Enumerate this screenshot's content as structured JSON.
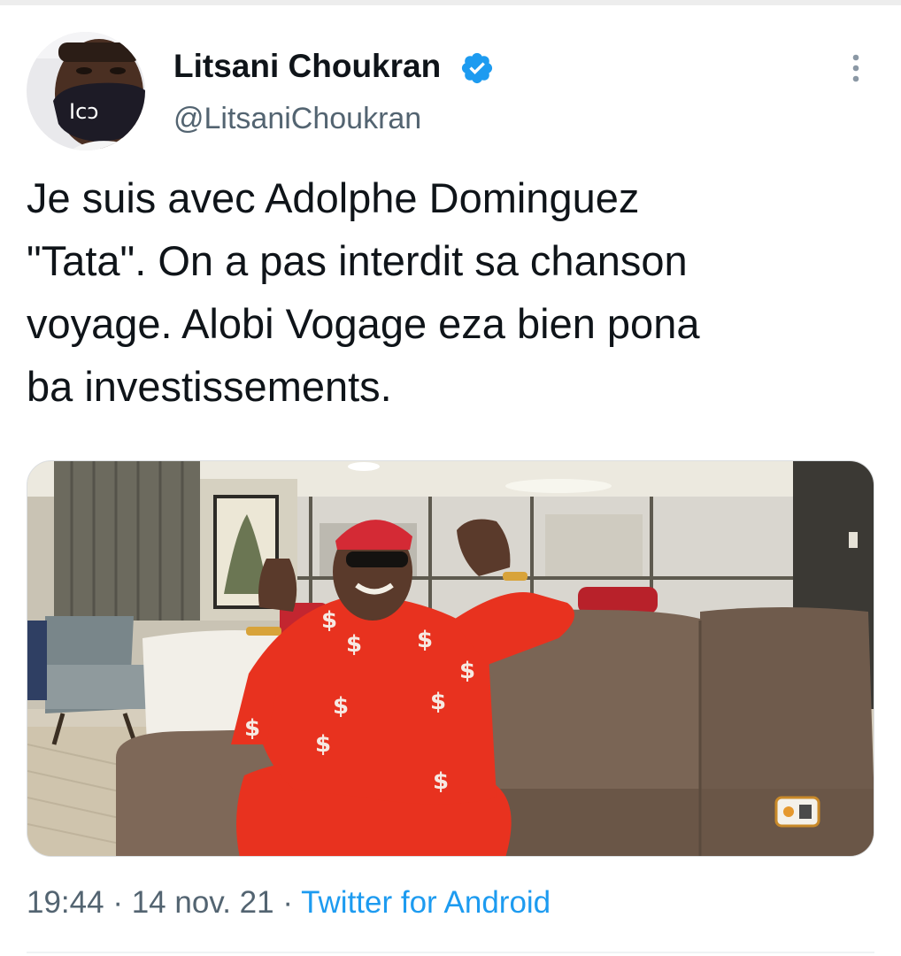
{
  "tweet": {
    "author": {
      "name": "Litsani Choukran",
      "handle": "@LitsaniChoukran",
      "verified": true,
      "mask_text": "Icɔ"
    },
    "text_lines": [
      "Je suis avec Adolphe Dominguez",
      "\"Tata\". On a pas interdit sa chanson",
      "voyage. Alobi Vogage eza bien pona",
      "ba investissements."
    ],
    "media": {
      "icon": "photo",
      "shirt_symbol": "$"
    },
    "meta": {
      "time": "19:44",
      "separator": "·",
      "date": "14 nov. 21",
      "source": "Twitter for Android"
    }
  },
  "colors": {
    "link": "#1d9bf0",
    "secondary_text": "#536471",
    "primary_text": "#0f1419",
    "verified": "#1d9bf0",
    "outfit_red": "#e8321f"
  }
}
